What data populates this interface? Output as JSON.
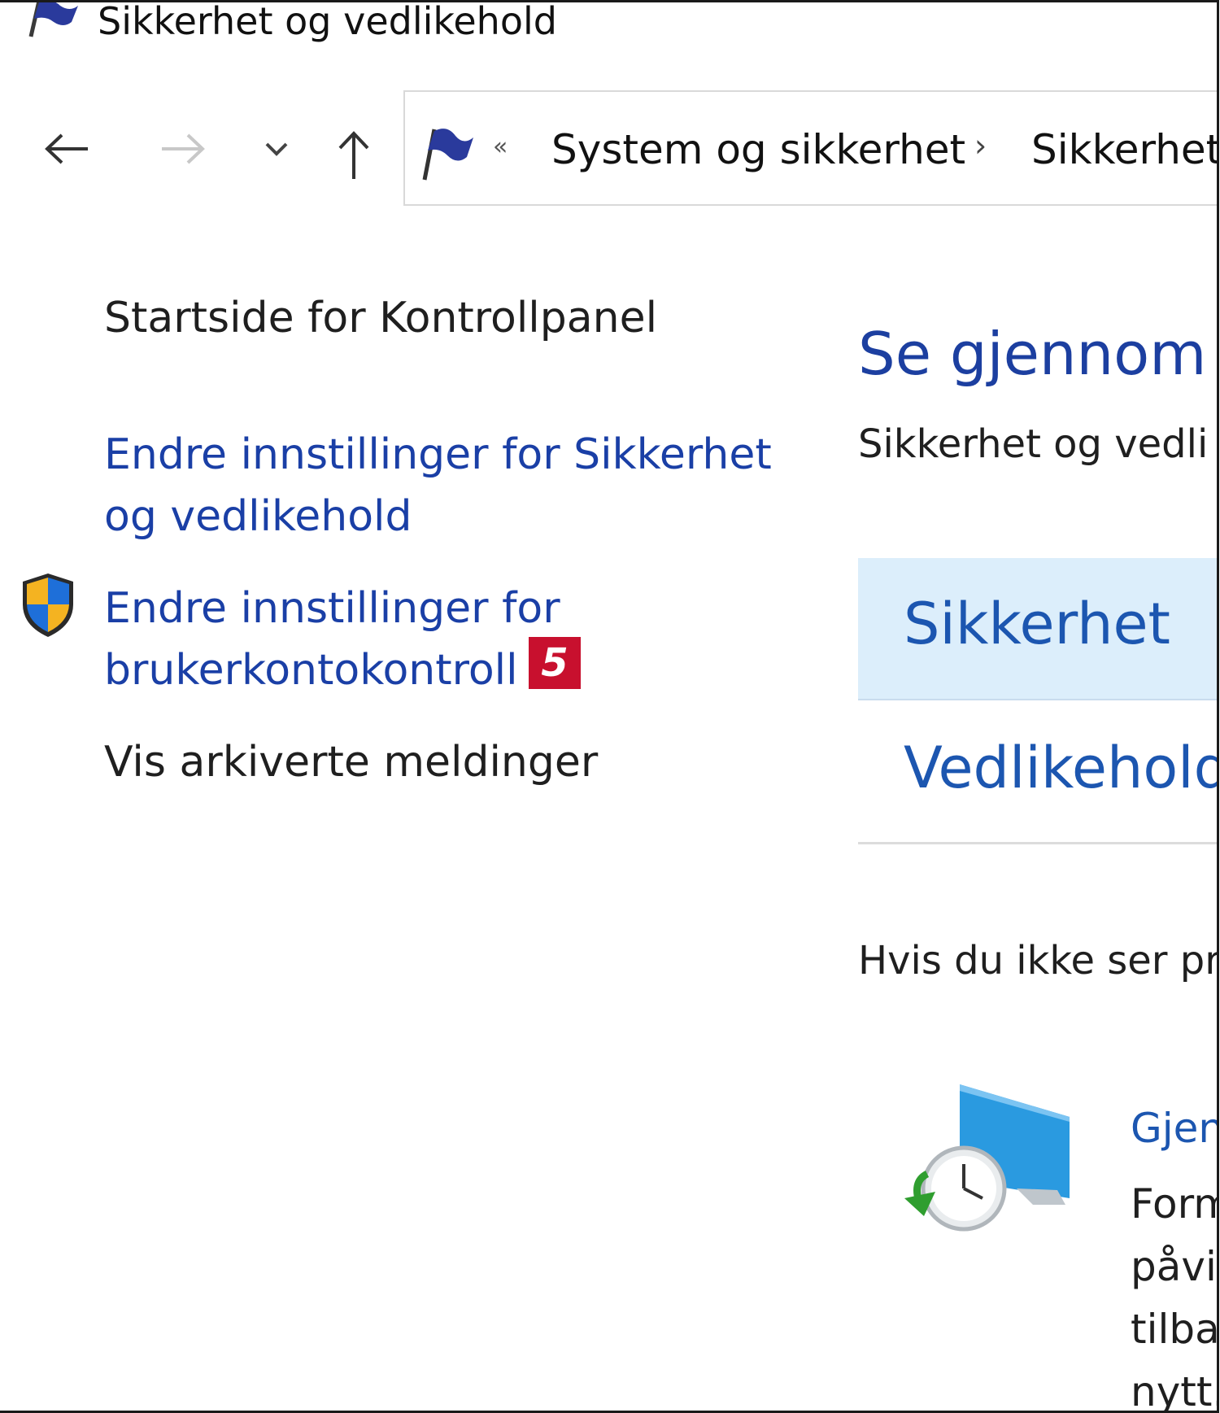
{
  "window": {
    "title": "Sikkerhet og vedlikehold"
  },
  "nav": {
    "back_icon": "back-arrow-icon",
    "forward_icon": "forward-arrow-icon",
    "recent_icon": "chevron-down-icon",
    "up_icon": "up-arrow-icon"
  },
  "address_bar": {
    "overflow": "«",
    "parts": [
      "System og sikkerhet",
      "Sikkerhet"
    ],
    "separator": "›"
  },
  "left_pane": {
    "home_link": "Startside for Kontrollpanel",
    "change_security_line1": "Endre innstillinger for Sikkerhet",
    "change_security_line2": "og vedlikehold",
    "uac_line1": "Endre innstillinger for",
    "uac_line2": "brukerkontokontroll",
    "archived": "Vis arkiverte meldinger",
    "badge": "5"
  },
  "main": {
    "heading": "Se gjennom n",
    "subtitle": "Sikkerhet og vedli",
    "sections": {
      "security": "Sikkerhet",
      "maintenance": "Vedlikehold"
    },
    "hint": "Hvis du ikke ser pr",
    "recovery": {
      "link": "Gjen",
      "lines": [
        "Form",
        "påvi",
        "tilba",
        "nytt."
      ]
    }
  },
  "colors": {
    "link_blue": "#1c56b0",
    "heading_blue": "#1c3fa0",
    "section_highlight": "#dceefb",
    "badge_red": "#c8102e"
  }
}
